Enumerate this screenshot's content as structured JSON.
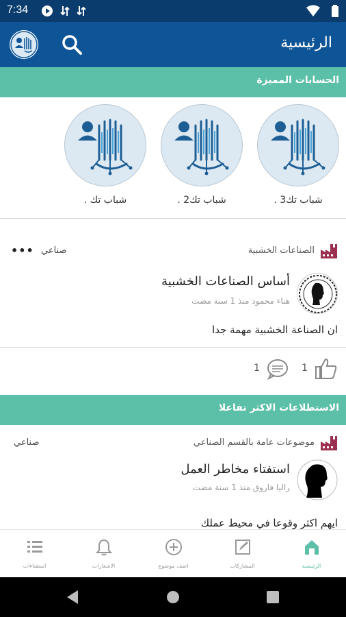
{
  "status_bar": {
    "time": "7:34"
  },
  "app_bar": {
    "title": "الرئيسية"
  },
  "featured": {
    "header": "الحسابات المميزة",
    "accounts": [
      {
        "name": "شباب تك3 ."
      },
      {
        "name": "شباب تك2 ."
      },
      {
        "name": "شباب تك ."
      }
    ]
  },
  "post1": {
    "category": "الصناعات الخشبية",
    "tag": "صناعي",
    "title": "أساس الصناعات الخشبية",
    "meta": "هناء محمود منذ 1 سنة مضت",
    "body": "ان الصناعة الخشبية مهمة جدا",
    "likes": "1",
    "comments": "1"
  },
  "polls": {
    "header": "الاستطلاعات الاكثر تفاعلا",
    "category": "موضوعات عامة بالقسم الصناعي",
    "tag": "صناعي",
    "title": "استفتاء مخاطر العمل",
    "meta": "راليا فاروق منذ 1 سنة مضت",
    "body": "ايهم اكثر وقوعا في محيط عملك"
  },
  "bottom_nav": {
    "items": [
      {
        "label": "الرئيسية"
      },
      {
        "label": "المشاركات"
      },
      {
        "label": "اضف موضوع"
      },
      {
        "label": "الاشعارات"
      },
      {
        "label": "استفتاءات"
      }
    ]
  },
  "colors": {
    "primary": "#0e5597",
    "status": "#0a3d6d",
    "accent": "#5cbfa7"
  },
  "icons": [
    "search-icon",
    "logo-icon",
    "factory-icon",
    "like-icon",
    "comment-icon",
    "more-icon",
    "home-icon",
    "edit-icon",
    "add-icon",
    "bell-icon",
    "list-icon"
  ]
}
